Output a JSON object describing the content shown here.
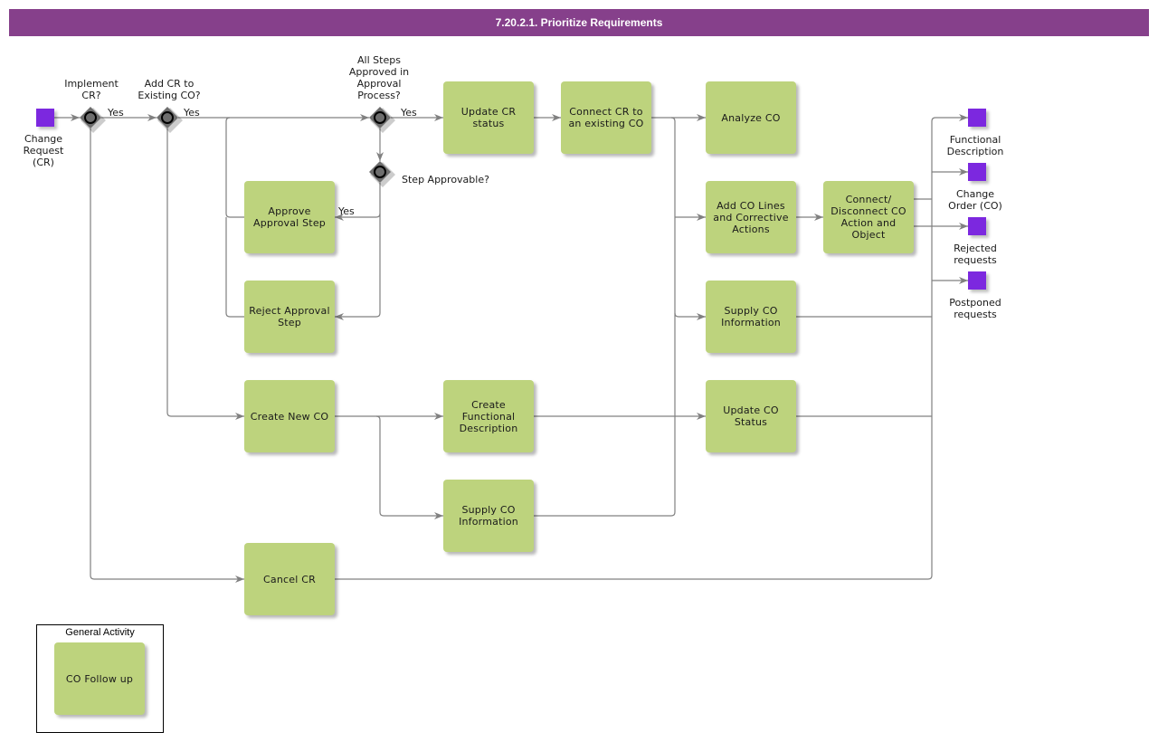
{
  "title": "7.20.2.1. Prioritize Requirements",
  "colors": {
    "title_bar": "#86408b",
    "activity": "#bdd37d",
    "event": "#7c28df",
    "gateway": "#6e6e6e",
    "connector": "#808080"
  },
  "start_event": {
    "label": "Change\nRequest\n(CR)"
  },
  "gateways": {
    "implement_cr": {
      "label": "Implement\nCR?",
      "yes": "Yes"
    },
    "add_to_existing": {
      "label": "Add CR to\nExisting CO?",
      "yes": "Yes"
    },
    "all_steps_approved": {
      "label": "All Steps\nApproved in\nApproval\nProcess?",
      "yes": "Yes"
    },
    "step_approvable": {
      "label": "Step Approvable?",
      "yes": "Yes"
    }
  },
  "activities": {
    "update_cr_status": "Update CR\nstatus",
    "connect_cr": "Connect CR to\nan existing CO",
    "analyze_co": "Analyze CO",
    "approve_step": "Approve\nApproval Step",
    "reject_step": "Reject Approval\nStep",
    "add_co_lines": "Add CO Lines\nand Corrective\nActions",
    "connect_disconnect": "Connect/\nDisconnect CO\nAction and\nObject",
    "supply_co_info_1": "Supply CO\nInformation",
    "create_new_co": "Create New CO",
    "create_func_desc": "Create\nFunctional\nDescription",
    "update_co_status": "Update CO\nStatus",
    "supply_co_info_2": "Supply CO\nInformation",
    "cancel_cr": "Cancel CR"
  },
  "end_events": [
    {
      "label": "Functional\nDescription"
    },
    {
      "label": "Change\nOrder (CO)"
    },
    {
      "label": "Rejected\nrequests"
    },
    {
      "label": "Postponed\nrequests"
    }
  ],
  "legend": {
    "title": "General Activity",
    "activity": "CO Follow up"
  }
}
